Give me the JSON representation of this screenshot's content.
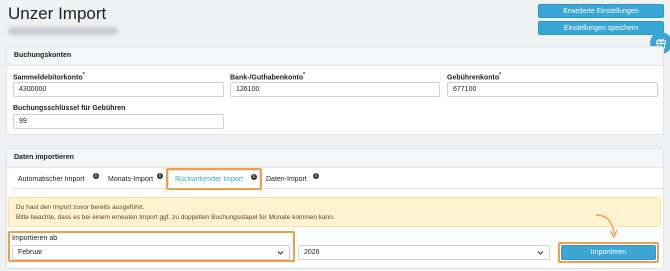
{
  "header": {
    "title": "Unzer Import",
    "btn_advanced": "Erweiterte Einstellungen",
    "btn_save": "Einstellungen speichern"
  },
  "accounts": {
    "title": "Buchungskonten",
    "sammel_label": "Sammeldebitorkonto",
    "sammel_req": "*",
    "sammel_value": "4300000",
    "bank_label": "Bank-/Guthabenkonto",
    "bank_req": "*",
    "bank_value": "126100",
    "fee_label": "Gebührenkonto",
    "fee_req": "*",
    "fee_value": "677100",
    "key_label": "Buchungsschlüssel für Gebühren",
    "key_value": "99"
  },
  "import": {
    "title": "Daten importieren",
    "tabs": [
      {
        "label": "Automatischer Import",
        "info": "i"
      },
      {
        "label": "Monats-Import",
        "info": "i"
      },
      {
        "label": "Rückwirkender Import",
        "info": "i"
      },
      {
        "label": "Daten-Import",
        "info": "i"
      }
    ],
    "alert_line1": "Du hast den Import zuvor bereits ausgeführt.",
    "alert_line2": "Bitte beachte, dass es bei einem erneuten Import ggf. zu doppelten Buchungsstapel für Monate kommen kann.",
    "from_label": "Importieren ab",
    "month_value": "Februar",
    "year_value": "2026",
    "btn_import": "Importieren"
  },
  "colors": {
    "accent": "#3aa6d6",
    "highlight": "#f0a04b",
    "alert_bg": "#fff3d1"
  },
  "icons": [
    "gift-icon",
    "info-icon",
    "chevron-down-icon",
    "arrow-curve-icon"
  ]
}
